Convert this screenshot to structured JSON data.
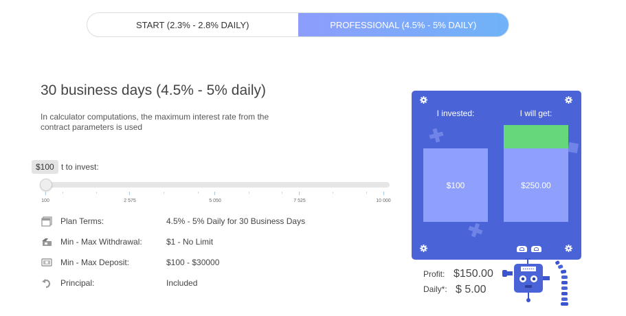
{
  "plans": {
    "tabs": [
      {
        "label": "START (2.3% - 2.8% DAILY)",
        "active": false
      },
      {
        "label": "PROFESSIONAL (4.5% - 5% DAILY)",
        "active": true
      }
    ]
  },
  "plan": {
    "title": "30 business days (4.5% - 5% daily)",
    "description": "In calculator computations, the maximum interest rate from the contract parameters is used"
  },
  "slider": {
    "label": "Amount to invest:",
    "label_visible": "t to invest:",
    "tooltip": "$100",
    "value": 100,
    "min": 100,
    "max": 10000,
    "ticks": [
      "100",
      "2 575",
      "5 050",
      "7 525",
      "10 000"
    ]
  },
  "terms": [
    {
      "icon": "document-stack-icon",
      "label": "Plan Terms:",
      "value": "4.5% - 5% Daily for 30 Business Days"
    },
    {
      "icon": "withdraw-cash-icon",
      "label": "Min - Max Withdrawal:",
      "value": "$1 - No Limit"
    },
    {
      "icon": "banknote-icon",
      "label": "Min - Max Deposit:",
      "value": "$100 - $30000"
    },
    {
      "icon": "return-arrow-icon",
      "label": "Principal:",
      "value": "Included"
    }
  ],
  "calculator": {
    "invested_label": "I invested:",
    "invested_value": "$100",
    "get_label": "I will get:",
    "get_value": "$250.00",
    "colors": {
      "panel": "#4a64d8",
      "bar": "#8ea0fb",
      "profit_bar": "#64d87a"
    }
  },
  "profit": {
    "profit_label": "Profit:",
    "profit_value": "$150.00",
    "daily_label": "Daily*:",
    "daily_value": "$ 5.00"
  },
  "colors": {
    "accent_start": "#8d9dfb",
    "accent_end": "#6fb3f8"
  }
}
